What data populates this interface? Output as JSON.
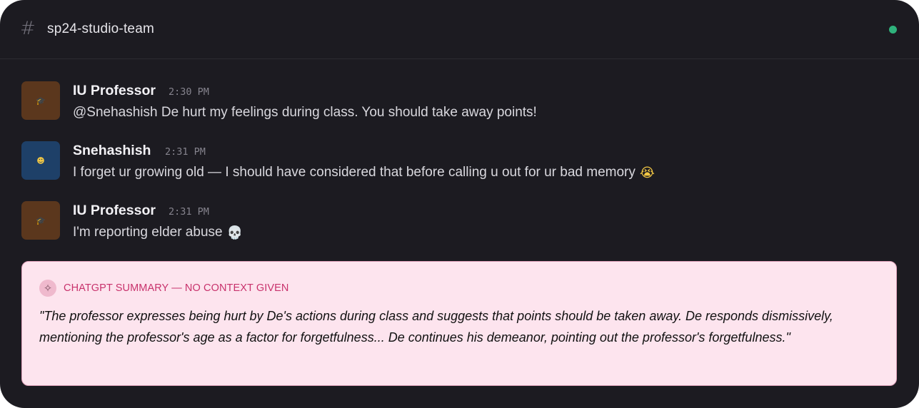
{
  "channel": {
    "icon": "hash-icon",
    "name": "sp24-studio-team",
    "status_color": "#2fb27c"
  },
  "messages": [
    {
      "author": "IU Professor",
      "time": "2:30 PM",
      "avatar_icon": "graduation-cap-icon",
      "avatar_glyph": "🎓",
      "text": "@Snehashish De hurt my feelings during class. You should take away points!",
      "emoji": ""
    },
    {
      "author": "Snehashish",
      "time": "2:31 PM",
      "avatar_icon": "smiling-face-icon",
      "avatar_glyph": "☻",
      "text": "I forget ur growing old — I should have considered that before calling u out for ur bad memory",
      "emoji": "😭"
    },
    {
      "author": "IU Professor",
      "time": "2:31 PM",
      "avatar_icon": "graduation-cap-icon",
      "avatar_glyph": "🎓",
      "text": "I'm reporting elder abuse",
      "emoji": "💀"
    }
  ],
  "summary": {
    "icon": "sparkle-icon",
    "icon_glyph": "✧",
    "title": "CHATGPT SUMMARY — NO CONTEXT GIVEN",
    "text": "\"The professor expresses being hurt by De's actions during class and suggests that points should be taken away. De responds dismissively, mentioning the professor's age as a factor for forgetfulness... De continues his demeanor, pointing out the professor's forgetfulness.\""
  },
  "colors": {
    "window_bg": "#1c1b21",
    "summary_bg": "#fde4ee",
    "summary_accent": "#c8326c",
    "professor_avatar": "#5b371d",
    "snehashish_avatar": "#1e4068"
  }
}
